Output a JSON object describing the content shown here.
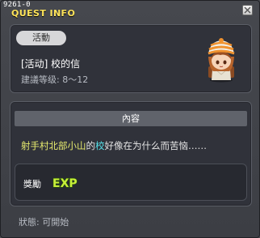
{
  "window": {
    "id_label": "9261-0",
    "title": "QUEST INFO"
  },
  "quest": {
    "category": "活動",
    "name": "[活动] 校的信",
    "level": "建議等级: 8～12"
  },
  "content": {
    "header": "內容",
    "description": {
      "part1": "射手村北部小山",
      "part2": "的",
      "part3": "校",
      "part4": "好像在为什么而苦恼……"
    }
  },
  "reward": {
    "label": "獎勵",
    "exp_icon_text": "EXP"
  },
  "status": "狀態: 可開始",
  "colors": {
    "title": "#ffe45a",
    "highlight_yellow": "#e6ea6e",
    "highlight_cyan": "#56e0e8",
    "exp_green": "#c8ee3a"
  },
  "icons": {
    "close": "close-icon",
    "npc": "npc-portrait-icon",
    "exp": "exp-icon"
  }
}
